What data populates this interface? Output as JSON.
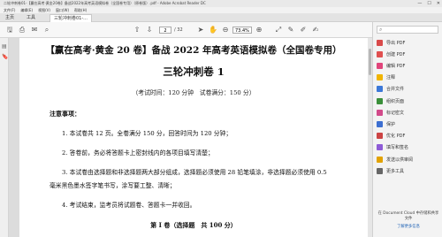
{
  "window": {
    "title": "二轮冲刺卷01-【赢在高考·黄金20卷】备战2022年高考英语模拟卷（全国卷专用）（原卷版）.pdf - Adobe Acrobat Reader DC",
    "controls": [
      "—",
      "☐",
      "✕"
    ]
  },
  "menu": [
    "文件(F)",
    "编辑(E)",
    "视图(V)",
    "窗口(W)",
    "帮助(H)"
  ],
  "tabs": [
    "主页",
    "工具",
    "三轮冲刺卷01-..."
  ],
  "toolbar": {
    "page_current": "2",
    "page_total": "/ 32",
    "zoom": "73.4%"
  },
  "document": {
    "title_line": "【赢在高考·黄金 20 卷】备战 2022 年高考英语模拟卷（全国卷专用）",
    "subtitle": "三轮冲刺卷 1",
    "exam_info": "（考试时间：120 分钟　试卷满分：150 分）",
    "notice_heading": "注意事项：",
    "items": [
      "1. 本试卷共 12 页。全卷满分 150 分，回答时间为 120 分钟；",
      "2. 答卷前，务必将答题卡上密封线内的各项目填写清楚；",
      "3. 本试卷由选择题和非选择题两大部分组成，选择题必须使用 28 铅笔填涂，非选择题必须使用 0.5",
      "毫米黑色墨水签字笔书写，涂写要工整、清晰；",
      "4. 考试结束，监考员将试题卷、答题卡一并收回。"
    ],
    "part_heading": "第 I 卷（选择题　共 100 分）"
  },
  "right_panel": {
    "tools": [
      {
        "label": "导出 PDF",
        "icon": "export-pdf-icon",
        "color": "#d94a4a"
      },
      {
        "label": "创建 PDF",
        "icon": "create-pdf-icon",
        "color": "#e05050"
      },
      {
        "label": "编辑 PDF",
        "icon": "edit-pdf-icon",
        "color": "#e0457b"
      },
      {
        "label": "注释",
        "icon": "comment-icon",
        "color": "#f0b400"
      },
      {
        "label": "合并文件",
        "icon": "combine-files-icon",
        "color": "#3c78d8"
      },
      {
        "label": "组织页面",
        "icon": "organize-pages-icon",
        "color": "#3a8f3a"
      },
      {
        "label": "标记密文",
        "icon": "redact-icon",
        "color": "#d24a8a"
      },
      {
        "label": "保护",
        "icon": "protect-icon",
        "color": "#3d6fd1"
      },
      {
        "label": "优化 PDF",
        "icon": "optimize-pdf-icon",
        "color": "#c44"
      },
      {
        "label": "填写和签名",
        "icon": "fill-sign-icon",
        "color": "#8e5bd6"
      },
      {
        "label": "发送以供审阅",
        "icon": "send-review-icon",
        "color": "#e2a200"
      },
      {
        "label": "更多工具",
        "icon": "more-tools-icon",
        "color": "#666666"
      }
    ],
    "cloud_message": "在 Document Cloud 中存储和共享文件",
    "cloud_link": "了解更多信息"
  }
}
